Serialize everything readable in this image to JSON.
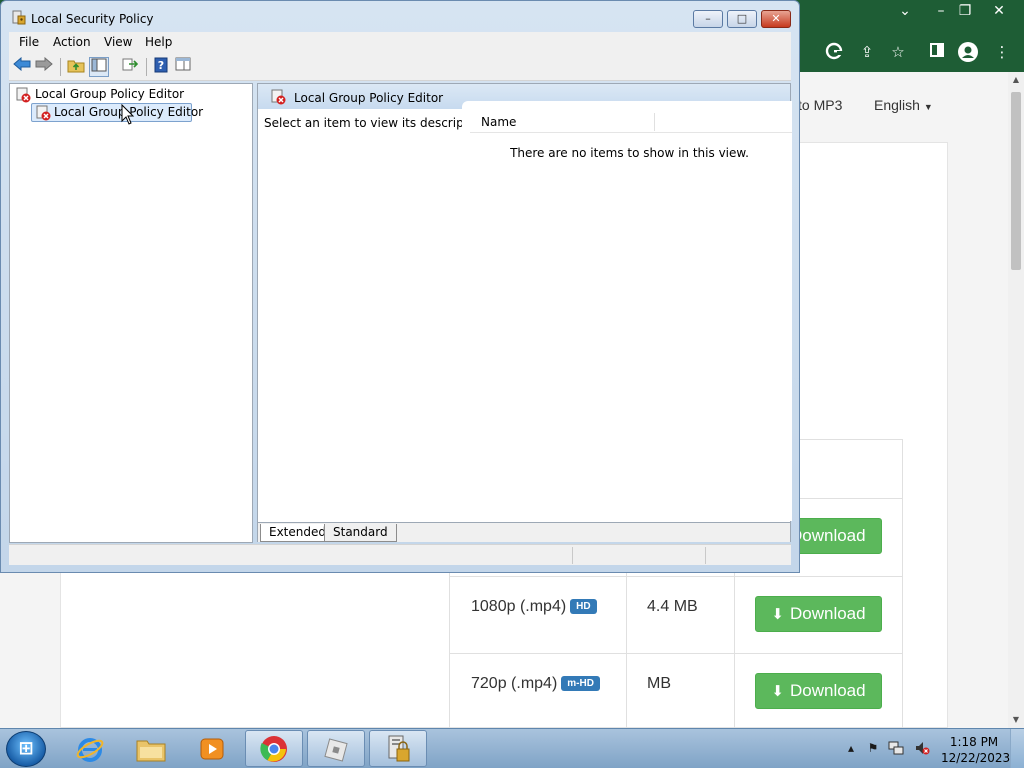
{
  "window": {
    "title": "Local Security Policy",
    "menu": [
      "File",
      "Action",
      "View",
      "Help"
    ],
    "controls": {
      "minimize": "–",
      "maximize": "□",
      "close": "✕"
    }
  },
  "tree": {
    "root_label": "Local Group Policy Editor",
    "child_label": "Local Group Policy Editor"
  },
  "right_pane": {
    "header_label": "Local Group Policy Editor",
    "description": "Select an item to view its description.",
    "column_name": "Name",
    "empty_message": "There are no items to show in this view.",
    "tabs": [
      "Extended",
      "Standard"
    ]
  },
  "browser": {
    "nav_mp3": "to MP3",
    "nav_language": "English",
    "downloads": [
      {
        "quality": "",
        "badge": "",
        "size": "",
        "button": "Download"
      },
      {
        "quality": "1080p (.mp4)",
        "badge": "HD",
        "size": "4.4 MB",
        "button": "Download"
      },
      {
        "quality": "720p (.mp4)",
        "badge": "m-HD",
        "size": "MB",
        "button": "Download"
      }
    ],
    "colors": {
      "toolbar": "#1e5d35",
      "download_button": "#5cb85c",
      "badge": "#337ab7",
      "accent_pink": "#d6105e"
    }
  },
  "taskbar": {
    "time": "1:18 PM",
    "date": "12/22/2023",
    "apps": [
      "internet-explorer-icon",
      "file-explorer-icon",
      "media-player-icon",
      "chrome-icon",
      "roblox-icon",
      "security-policy-icon"
    ]
  }
}
